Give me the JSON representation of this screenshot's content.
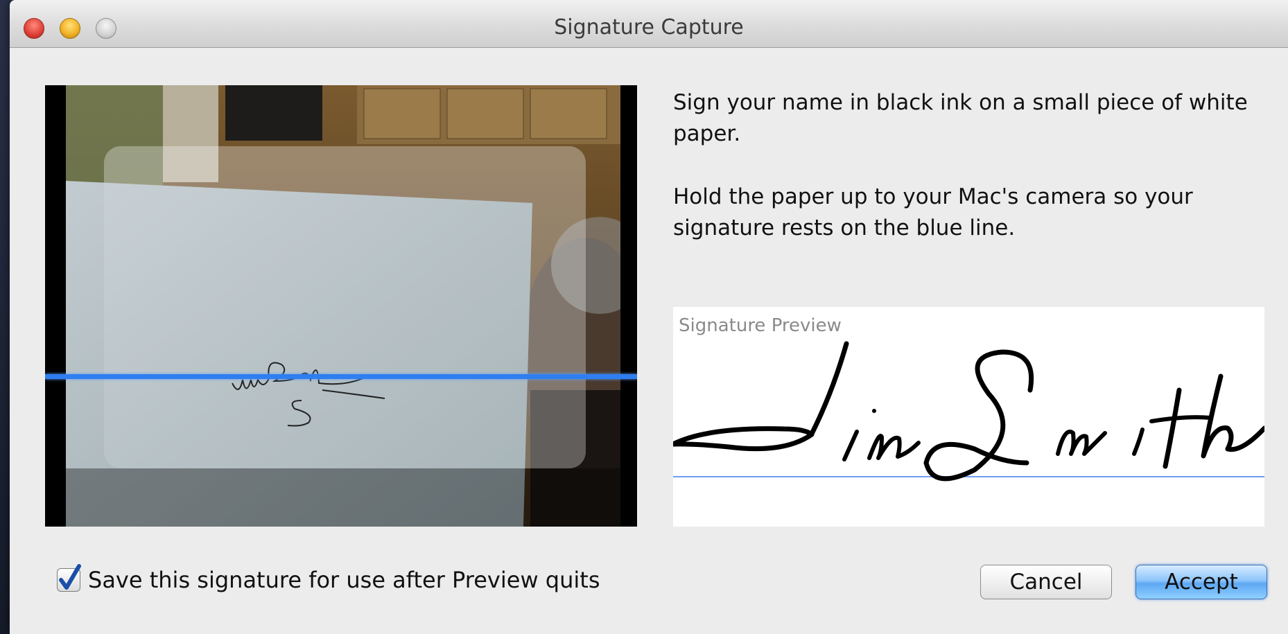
{
  "window": {
    "title": "Signature Capture"
  },
  "instructions": {
    "line1": "Sign your name in black ink on a small piece of white paper.",
    "line2": "Hold the paper up to your Mac's camera so your signature rests on the blue line."
  },
  "preview": {
    "label": "Signature Preview",
    "signature_text": "Jim Smith"
  },
  "options": {
    "save_label": "Save this signature for use after Preview quits",
    "save_checked": true
  },
  "buttons": {
    "cancel": "Cancel",
    "accept": "Accept"
  },
  "colors": {
    "scan_line": "#2f7ef0",
    "baseline": "#6f9ef5",
    "accept_button": "#5ea8f3",
    "close": "#e0443a",
    "minimize": "#f2b327",
    "zoom": "#d2d2d2"
  },
  "icons": [
    "close-icon",
    "minimize-icon",
    "zoom-icon",
    "checkmark-icon"
  ]
}
